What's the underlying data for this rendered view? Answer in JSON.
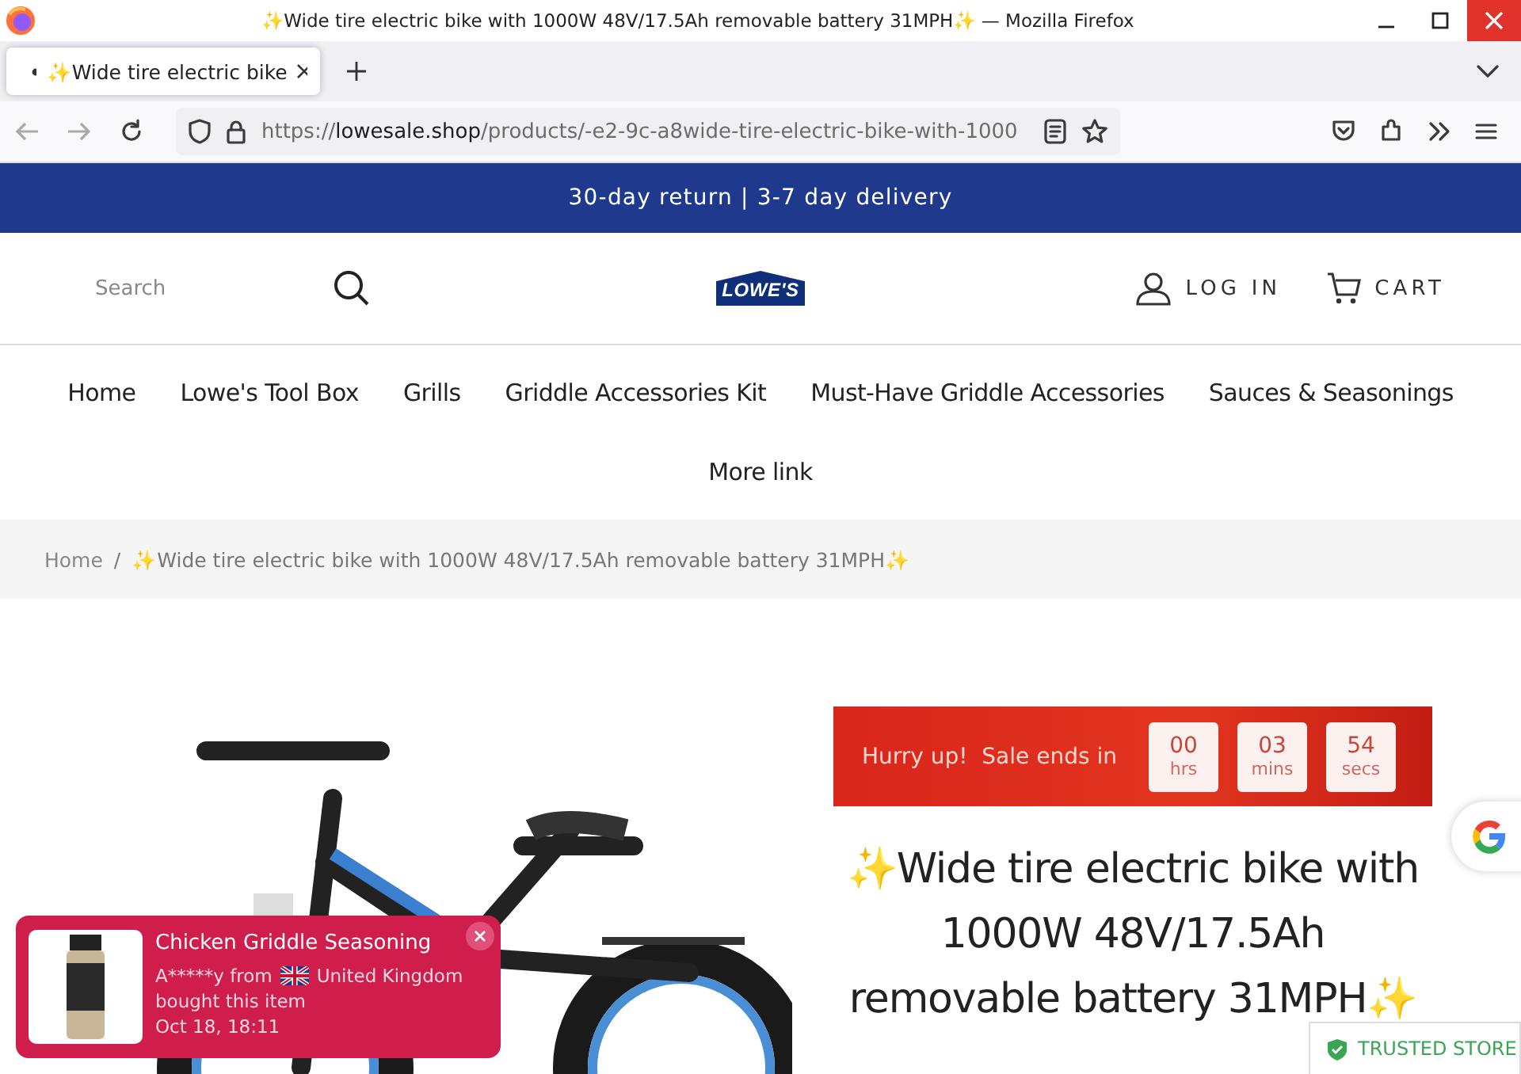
{
  "browser": {
    "window_title": "✨Wide tire electric bike with 1000W 48V/17.5Ah removable battery 31MPH✨ — Mozilla Firefox",
    "tabs": [
      {
        "title": "✨Wide tire electric bike",
        "selected": true
      }
    ],
    "url": {
      "scheme": "https://",
      "domain": "lowesale.shop",
      "path": "/products/-e2-9c-a8wide-tire-electric-bike-with-1000"
    }
  },
  "banner": "30-day return | 3-7 day delivery",
  "header": {
    "search_placeholder": "Search",
    "logo": "LOWE'S",
    "login": "LOG IN",
    "cart": "CART"
  },
  "nav": [
    "Home",
    "Lowe's Tool Box",
    "Grills",
    "Griddle Accessories Kit",
    "Must-Have Griddle Accessories",
    "Sauces & Seasonings",
    "More link"
  ],
  "breadcrumb_separator": "/",
  "breadcrumb": [
    "Home",
    "✨Wide tire electric bike with 1000W 48V/17.5Ah removable battery 31MPH✨"
  ],
  "countdown": {
    "label": "Hurry up!  Sale ends in",
    "units": [
      {
        "value": "00",
        "unit": "hrs"
      },
      {
        "value": "03",
        "unit": "mins"
      },
      {
        "value": "54",
        "unit": "secs"
      }
    ]
  },
  "product": {
    "title": "✨Wide tire electric bike with 1000W 48V/17.5Ah removable battery 31MPH✨"
  },
  "popup": {
    "product": "Chicken Griddle Seasoning",
    "buyer": "A*****y from",
    "country": "United Kingdom",
    "action": "bought this item",
    "time": "Oct 18, 18:11"
  },
  "trust_badge": "TRUSTED STORE"
}
